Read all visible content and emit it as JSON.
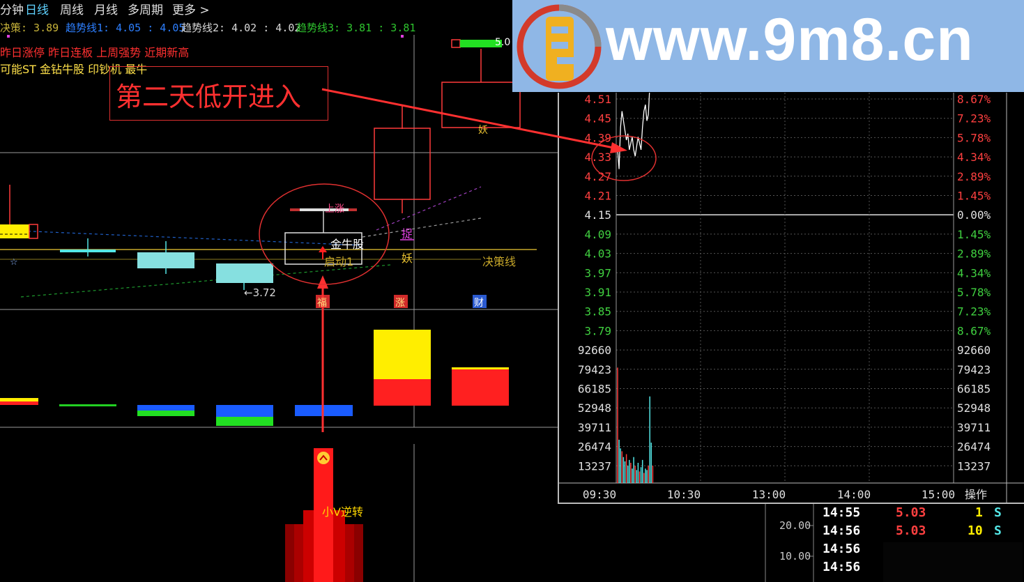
{
  "tabs": [
    "分钟",
    "日线",
    "周线",
    "月线",
    "多周期",
    "更多 >"
  ],
  "active_tab": "日线",
  "indicators": {
    "juece": "决策: 3.89",
    "trend1": "趋势线1: 4.05 : 4.05",
    "trend2": "趋势线2: 4.02 : 4.02",
    "trend3": "趋势线3: 3.81 : 3.81"
  },
  "signals": {
    "line1": "昨日涨停 昨日连板 上周强势 近期新高",
    "line2": "可能ST 金钻牛股 印钞机 最牛"
  },
  "annotation": "第二天低开进入",
  "kline_labels": {
    "price_low": "←3.72",
    "jinniu": "金牛股",
    "qidong": "启动1",
    "shangzhang": "上涨",
    "juece_line": "决策线",
    "zhuo": "捉",
    "yao": "妖",
    "yao_top": "妖",
    "high_mark": "5.0",
    "marker_fu": "福",
    "marker_zhang": "涨",
    "marker_cai": "财"
  },
  "bottom_label": "小V逆转",
  "watermark": "www.9m8.cn",
  "intraday": {
    "price_labels": [
      "4.51",
      "4.45",
      "4.39",
      "4.33",
      "4.27",
      "4.21",
      "4.15",
      "4.09",
      "4.03",
      "3.97",
      "3.91",
      "3.85",
      "3.79"
    ],
    "pct_labels": [
      "8.67%",
      "7.23%",
      "5.78%",
      "4.34%",
      "2.89%",
      "1.45%",
      "0.00%",
      "1.45%",
      "2.89%",
      "4.34%",
      "5.78%",
      "7.23%",
      "8.67%"
    ],
    "volume_labels": [
      "92660",
      "79423",
      "66185",
      "52948",
      "39711",
      "26474",
      "13237"
    ],
    "time_labels": [
      "09:30",
      "10:30",
      "13:00",
      "14:00",
      "15:00"
    ],
    "operate": "操作"
  },
  "lower_scale": [
    "20.00",
    "10.00"
  ],
  "trades": [
    {
      "time": "14:55",
      "price": "5.03",
      "vol": "1",
      "side": "S"
    },
    {
      "time": "14:56",
      "price": "5.03",
      "vol": "10",
      "side": "S"
    },
    {
      "time": "14:56",
      "price": "",
      "vol": "",
      "side": ""
    },
    {
      "time": "14:56",
      "price": "",
      "vol": "",
      "side": ""
    }
  ],
  "chart_data": {
    "type": "line",
    "title": "",
    "price_axis": [
      4.51,
      4.45,
      4.39,
      4.33,
      4.27,
      4.21,
      4.15,
      4.09,
      4.03,
      3.97,
      3.91,
      3.85,
      3.79
    ],
    "reference_price": 4.15,
    "volume_axis": [
      92660,
      79423,
      66185,
      52948,
      39711,
      26474,
      13237
    ],
    "x_ticks": [
      "09:30",
      "10:30",
      "13:00",
      "14:00",
      "15:00"
    ],
    "series": [
      {
        "x": [
          0,
          2,
          4,
          6,
          8,
          10,
          12,
          14,
          16,
          18,
          20,
          22,
          24,
          26,
          28,
          30,
          32,
          34,
          36,
          38,
          40,
          42,
          44,
          46,
          48
        ],
        "values": [
          4.35,
          4.29,
          4.42,
          4.47,
          4.44,
          4.41,
          4.38,
          4.4,
          4.35,
          4.37,
          4.39,
          4.35,
          4.33,
          4.36,
          4.39,
          4.37,
          4.35,
          4.42,
          4.47,
          4.49,
          4.44,
          4.46,
          4.55,
          4.6,
          4.65
        ]
      }
    ],
    "volume": [
      80000,
      30000,
      24000,
      22000,
      18000,
      15000,
      20000,
      12000,
      16000,
      14000,
      10000,
      18000,
      12000,
      9000,
      14000,
      8000,
      11000,
      16000,
      7000,
      10000,
      9000,
      12000,
      60000,
      28000,
      12000
    ],
    "colors": {
      "up": "#ff3b3b",
      "down": "#54e6e6",
      "line": "#ffffff"
    }
  }
}
